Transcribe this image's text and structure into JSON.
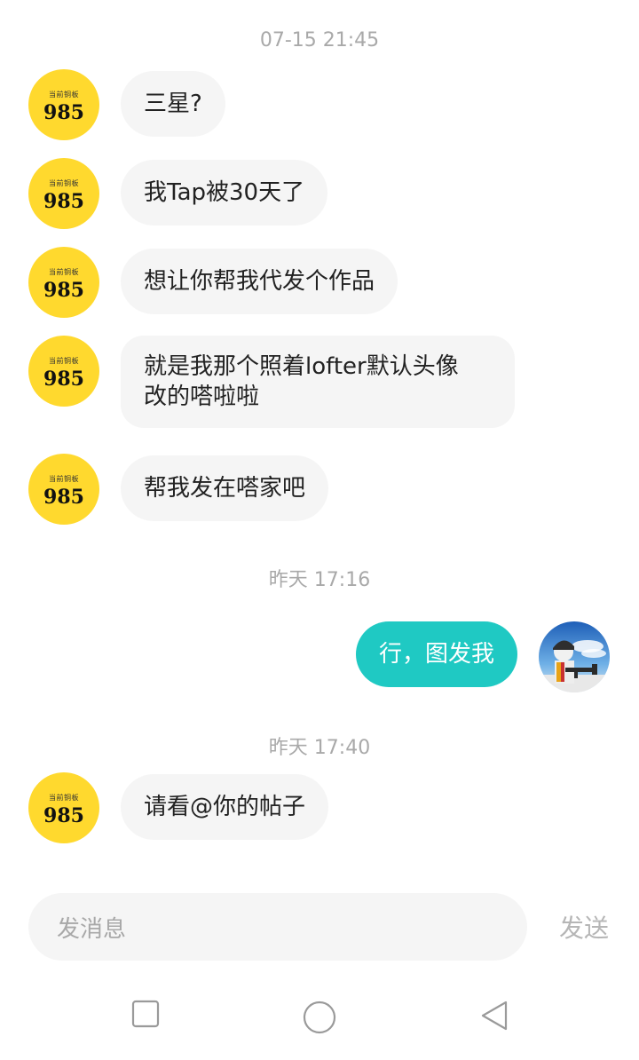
{
  "colors": {
    "background": "#FFFFFF",
    "incoming_bubble": "#F5F5F5",
    "outgoing_bubble": "#1FC9C3",
    "avatar_yellow": "#FFD92E",
    "timestamp": "#A9A9A9"
  },
  "contact_avatar": {
    "top_text": "当前铜板",
    "number": "985"
  },
  "timestamps": [
    "07-15 21:45",
    "昨天 17:16",
    "昨天 17:40"
  ],
  "messages": [
    {
      "sender": "contact",
      "text": "三星?"
    },
    {
      "sender": "contact",
      "text": "我Tap被30天了"
    },
    {
      "sender": "contact",
      "text": "想让你帮我代发个作品"
    },
    {
      "sender": "contact",
      "line1": "就是我那个照着lofter默认头像",
      "line2": "改的嗒啦啦"
    },
    {
      "sender": "contact",
      "text": "帮我发在嗒家吧"
    },
    {
      "sender": "me",
      "text": "行，图发我"
    },
    {
      "sender": "contact",
      "text": "请看@你的帖子"
    }
  ],
  "composer": {
    "placeholder": "发消息",
    "send_label": "发送"
  },
  "nav_bar": {
    "icons": [
      "square-recent-apps-icon",
      "circle-home-icon",
      "triangle-back-icon"
    ]
  }
}
